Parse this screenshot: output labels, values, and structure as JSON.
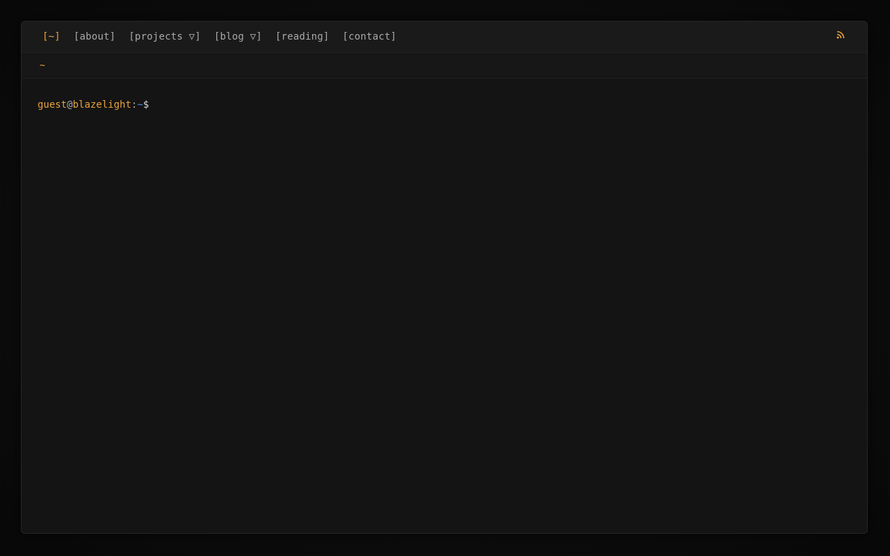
{
  "nav": {
    "items": [
      {
        "label": "[~]",
        "active": true
      },
      {
        "label": "[about]",
        "active": false
      },
      {
        "label": "[projects ▽]",
        "active": false
      },
      {
        "label": "[blog ▽]",
        "active": false
      },
      {
        "label": "[reading]",
        "active": false
      },
      {
        "label": "[contact]",
        "active": false
      }
    ],
    "rss_icon": "rss-icon"
  },
  "path": {
    "current": "~"
  },
  "prompt": {
    "user": "guest",
    "at": "@",
    "host": "blazelight",
    "colon": ":",
    "path": "~",
    "symbol": "$"
  },
  "colors": {
    "accent": "#e8a33a",
    "path_blue": "#4f8fd6",
    "text_muted": "#a9a9a9",
    "background": "#141414"
  }
}
